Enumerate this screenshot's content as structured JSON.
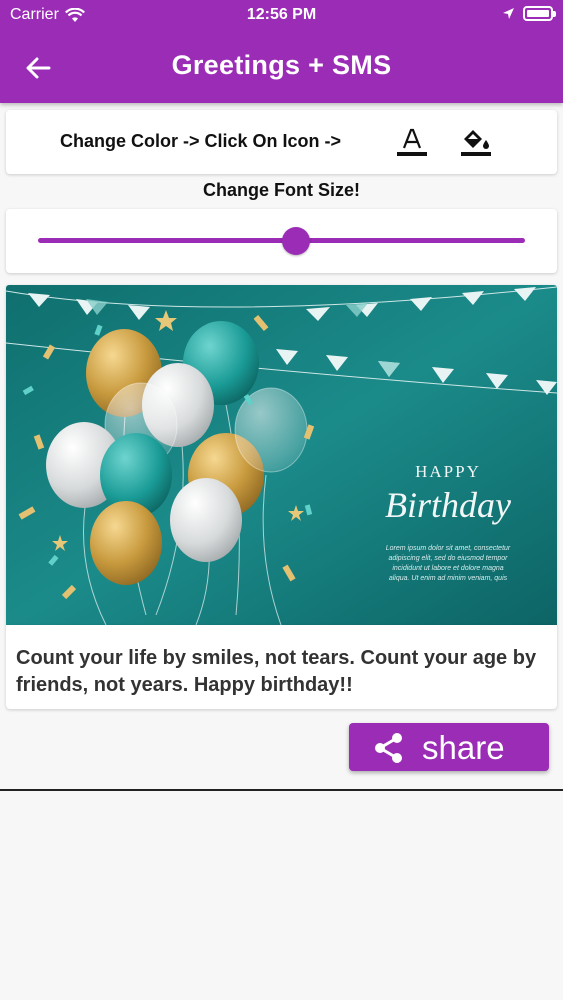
{
  "status_bar": {
    "carrier": "Carrier",
    "time": "12:56 PM"
  },
  "app_bar": {
    "title": "Greetings + SMS",
    "background_color": "#9b2cb5"
  },
  "color_control": {
    "label": "Change Color -> Click On Icon ->",
    "text_color_icon": "text-color-icon",
    "fill_color_icon": "fill-color-icon"
  },
  "font_size": {
    "label": "Change Font Size!",
    "slider_value": 0.53
  },
  "card_image": {
    "headline": "HAPPY",
    "script": "Birthday",
    "body_lines": [
      "Lorem ipsum dolor sit amet, consectetur",
      "adipiscing elit, sed do eiusmod tempor",
      "incididunt ut labore et dolore magna",
      "aliqua. Ut enim ad minim veniam, quis"
    ]
  },
  "message": {
    "text": "Count your life by smiles, not tears. Count your age by friends, not years. Happy birthday!!"
  },
  "share": {
    "label": "share"
  },
  "colors": {
    "accent": "#9b2cb5",
    "teal": "#1f8a87",
    "gold": "#c89a3e"
  }
}
